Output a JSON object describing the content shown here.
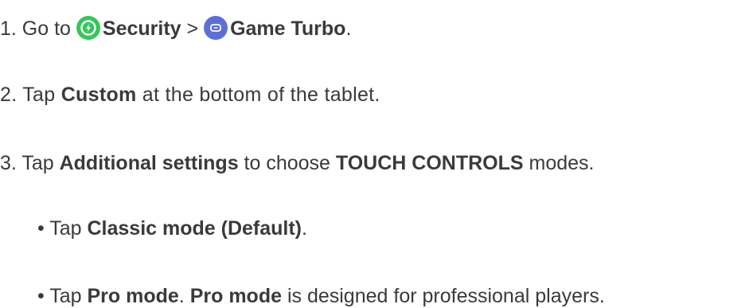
{
  "steps": {
    "step1": {
      "prefix": "1. Go to ",
      "security_label": "Security",
      "separator": " > ",
      "game_turbo_label": "Game Turbo",
      "suffix": "."
    },
    "step2": {
      "prefix": "2. Tap ",
      "custom_label": "Custom",
      "suffix": " at the bottom of the tablet."
    },
    "step3": {
      "prefix": "3. Tap ",
      "additional_settings_label": "Additional settings",
      "middle": " to choose ",
      "touch_controls_label": "TOUCH CONTROLS",
      "suffix": " modes."
    },
    "bullet1": {
      "prefix": "• Tap ",
      "classic_label": "Classic mode (Default)",
      "suffix": "."
    },
    "bullet2": {
      "prefix": "• Tap ",
      "pro_label_1": "Pro mode",
      "middle": ". ",
      "pro_label_2": "Pro mode",
      "suffix": " is designed for professional players."
    }
  },
  "icons": {
    "security": {
      "name": "security-app-icon",
      "color": "#34c759"
    },
    "game_turbo": {
      "name": "game-turbo-app-icon",
      "color": "#5b6fd6"
    }
  }
}
